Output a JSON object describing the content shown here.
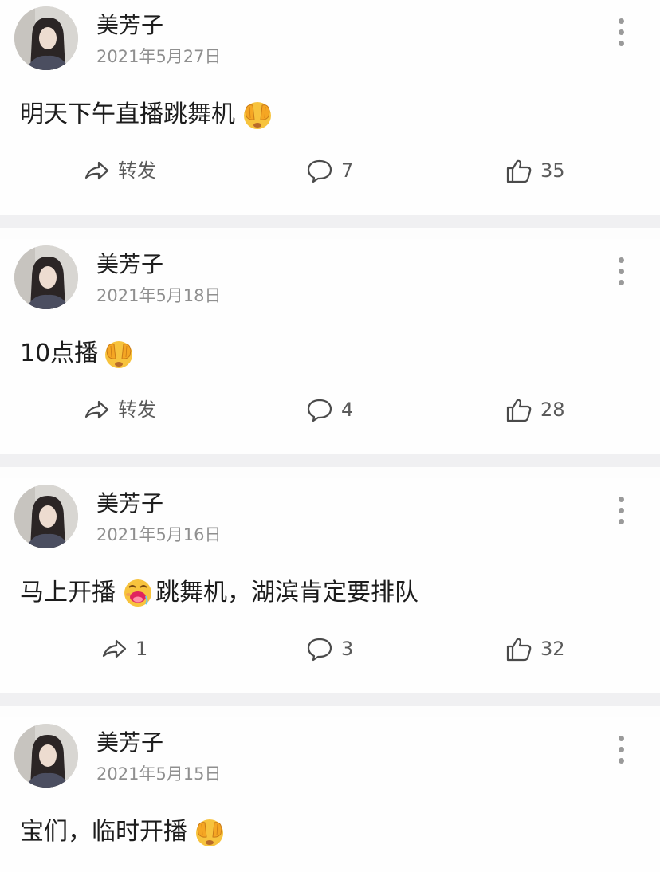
{
  "posts": [
    {
      "author": "美芳子",
      "date": "2021年5月27日",
      "text": "明天下午直播跳舞机",
      "emoji": "hands-over-eyes-emoji",
      "text_after": "",
      "share": "转发",
      "comments": "7",
      "likes": "35"
    },
    {
      "author": "美芳子",
      "date": "2021年5月18日",
      "text": "10点播",
      "emoji": "hands-over-eyes-emoji",
      "text_after": "",
      "share": "转发",
      "comments": "4",
      "likes": "28"
    },
    {
      "author": "美芳子",
      "date": "2021年5月16日",
      "text": "马上开播",
      "emoji": "drooling-face-emoji",
      "text_after": "跳舞机，湖滨肯定要排队",
      "share": "1",
      "comments": "3",
      "likes": "32"
    },
    {
      "author": "美芳子",
      "date": "2021年5月15日",
      "text": "宝们，临时开播",
      "emoji": "hands-over-eyes-emoji",
      "text_after": "",
      "share": "",
      "comments": "",
      "likes": ""
    }
  ],
  "colors": {
    "page_bg": "#fdfdfd",
    "separator": "#f0f0f2",
    "date_text": "#8f8f8f",
    "action_text": "#5a5a5a",
    "emoji_yellow": "#f7c33d"
  },
  "icons": {
    "share": "share-arrow-icon",
    "comment": "comment-bubble-icon",
    "like": "thumbs-up-icon",
    "more": "more-vertical-icon"
  }
}
